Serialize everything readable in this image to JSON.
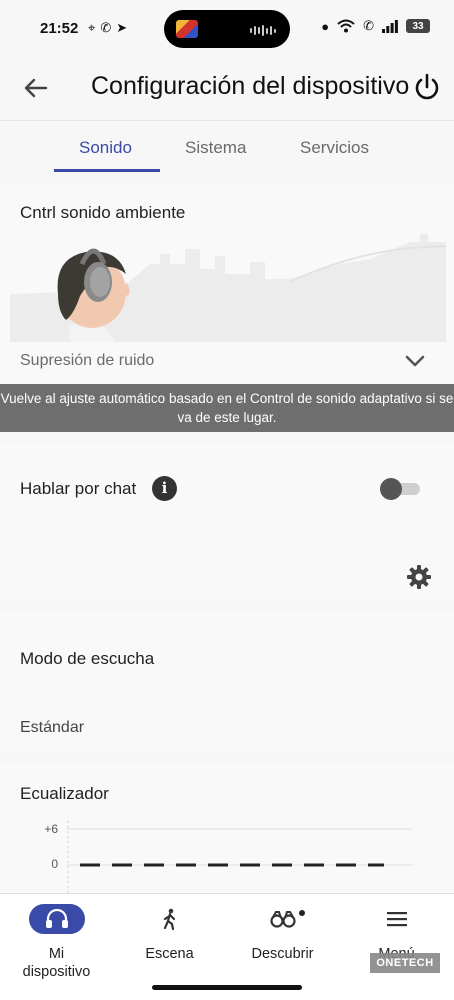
{
  "status_bar": {
    "time": "21:52",
    "battery": "33"
  },
  "header": {
    "title": "Configuración del dispositivo"
  },
  "tabs": [
    {
      "label": "Sonido",
      "active": true
    },
    {
      "label": "Sistema",
      "active": false
    },
    {
      "label": "Servicios",
      "active": false
    }
  ],
  "ambient_sound": {
    "heading": "Cntrl sonido ambiente",
    "mode": "Supresión de ruido",
    "banner": "Vuelve al ajuste automático basado en el Control de sonido adaptativo si se va de este lugar."
  },
  "chat": {
    "label": "Hablar por chat",
    "info_glyph": "i",
    "toggle_on": false
  },
  "listening_mode": {
    "heading": "Modo de escucha",
    "value": "Estándar"
  },
  "equalizer": {
    "heading": "Ecualizador",
    "tick_top": "+6",
    "tick_mid": "0"
  },
  "bottom_nav": [
    {
      "line1": "Mi",
      "line2": "dispositivo",
      "icon": "headphones-icon",
      "active": true
    },
    {
      "line1": "Escena",
      "line2": "",
      "icon": "walking-person-icon",
      "active": false
    },
    {
      "line1": "Descubrir",
      "line2": "",
      "icon": "binoculars-icon",
      "active": false
    },
    {
      "line1": "Menú",
      "line2": "",
      "icon": "hamburger-menu-icon",
      "active": false
    }
  ],
  "watermark": "ONETECH",
  "colors": {
    "accent": "#3a4aa8",
    "banner": "#6e6e6e",
    "background": "#f7f7f7"
  }
}
